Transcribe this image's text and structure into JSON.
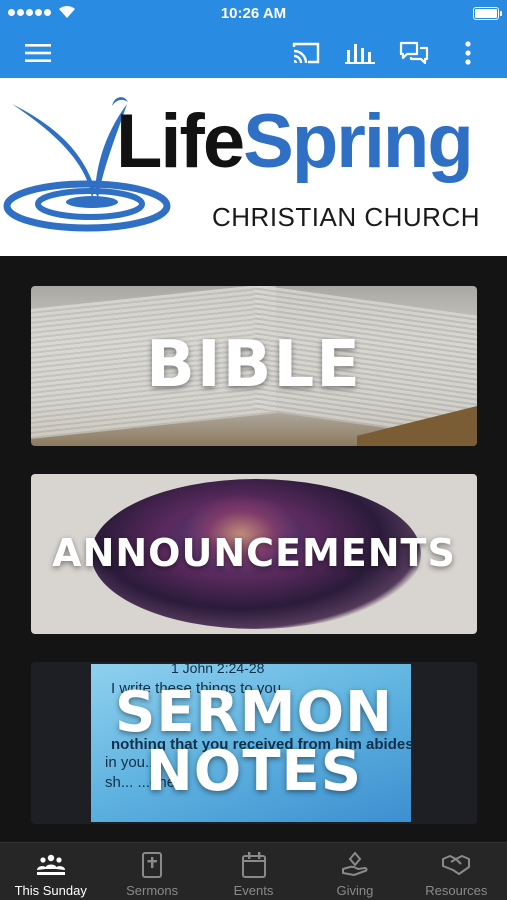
{
  "status_bar": {
    "time": "10:26 AM"
  },
  "app_bar": {
    "icons": [
      "menu-icon",
      "cast-icon",
      "poll-icon",
      "chat-icon",
      "more-vertical-icon"
    ]
  },
  "logo": {
    "word_life": "Life",
    "word_spring": "Spring",
    "subtitle": "CHRISTIAN CHURCH"
  },
  "tiles": [
    {
      "label": "BIBLE"
    },
    {
      "label": "ANNOUNCEMENTS"
    },
    {
      "label": "SERMON\nNOTES",
      "line1": "SERMON",
      "line2": "NOTES",
      "screen_text": [
        "1 John 2:24-28",
        "I write these things to you",
        "nothing that you received from him abides",
        "in you...",
        "sh...        ...one"
      ]
    }
  ],
  "tab_bar": {
    "tabs": [
      {
        "label": "This Sunday",
        "icon": "people-icon",
        "active": true
      },
      {
        "label": "Sermons",
        "icon": "bible-icon",
        "active": false
      },
      {
        "label": "Events",
        "icon": "calendar-icon",
        "active": false
      },
      {
        "label": "Giving",
        "icon": "giving-hand-icon",
        "active": false
      },
      {
        "label": "Resources",
        "icon": "handshake-icon",
        "active": false
      }
    ]
  },
  "colors": {
    "primary": "#2a8be2",
    "logo_blue": "#2f6fc4",
    "background": "#141414",
    "tab_bar": "#262626"
  }
}
